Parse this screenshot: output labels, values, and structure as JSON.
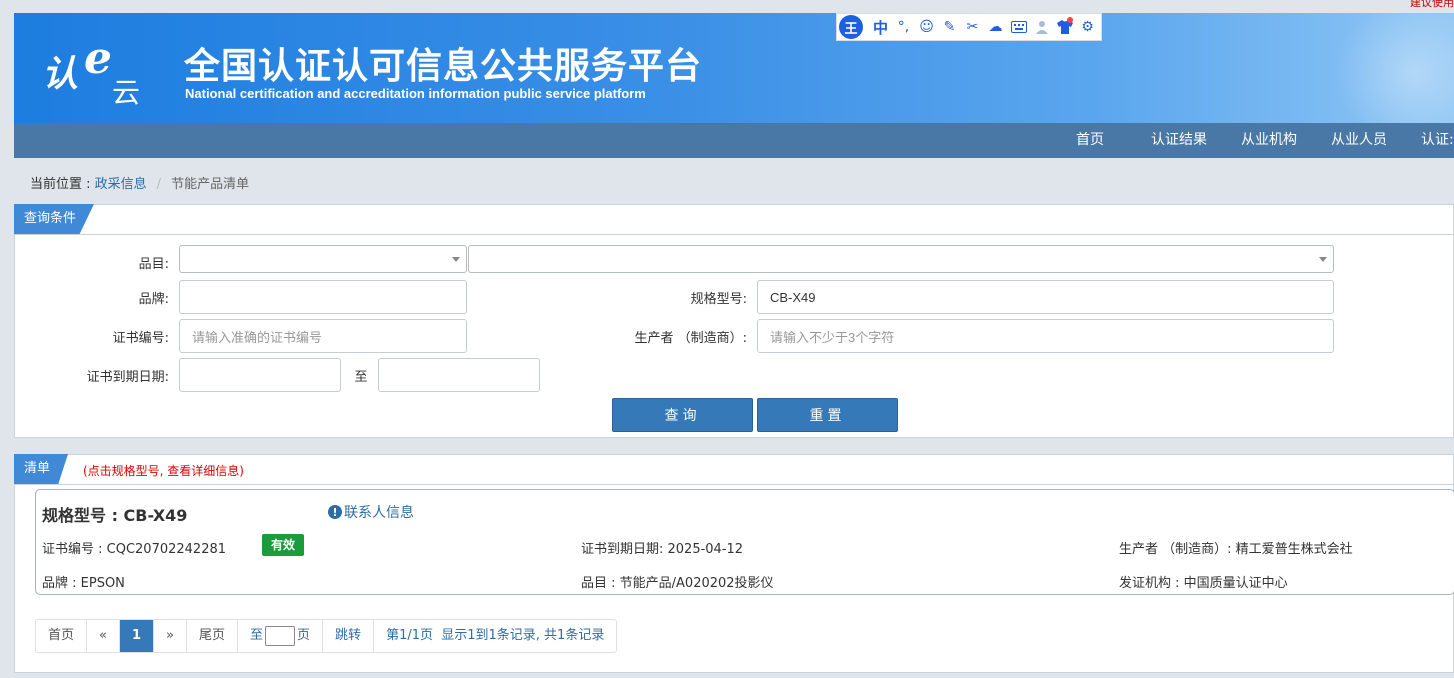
{
  "top_note": "建议使用",
  "header": {
    "logo_char1": "认",
    "logo_char2": "e",
    "logo_char3": "云",
    "title_cn": "全国认证认可信息公共服务平台",
    "title_en": "National certification and accreditation information public service platform"
  },
  "ime_toolbar": {
    "badge": "王",
    "lang": "中",
    "icons": [
      "punctuation-icon",
      "emoji-icon",
      "pen-icon",
      "scissors-icon",
      "cloud-icon",
      "keyboard-icon",
      "user-icon",
      "shirt-icon",
      "gear-icon"
    ]
  },
  "nav": {
    "items": [
      "首页",
      "认证结果",
      "从业机构",
      "从业人员",
      "认证:"
    ]
  },
  "breadcrumb": {
    "prefix": "当前位置 : ",
    "link": "政采信息",
    "sep": "/",
    "current": "节能产品清单"
  },
  "query": {
    "tab": "查询条件",
    "category_label": "品目:",
    "brand_label": "品牌:",
    "brand_value": "",
    "model_label": "规格型号:",
    "model_value": "CB-X49",
    "cert_label": "证书编号:",
    "cert_placeholder": "请输入准确的证书编号",
    "producer_label": "生产者 （制造商）:",
    "producer_placeholder": "请输入不少于3个字符",
    "expiry_label": "证书到期日期:",
    "to_label": "至",
    "search_button": "查询",
    "reset_button": "重置"
  },
  "list": {
    "tab": "清单",
    "hint": "(点击规格型号, 查看详细信息)",
    "item": {
      "model": "规格型号 : CB-X49",
      "contact": "联系人信息",
      "cert_no": "证书编号 : CQC20702242281",
      "status": "有效",
      "expiry": "证书到期日期: 2025-04-12",
      "producer": "生产者 （制造商）: 精工爱普生株式会社",
      "brand": "品牌 : EPSON",
      "category": "品目 : 节能产品/A020202投影仪",
      "issuer": "发证机构 : 中国质量认证中心"
    }
  },
  "pager": {
    "first": "首页",
    "prev": "«",
    "current": "1",
    "next": "»",
    "last": "尾页",
    "goto_prefix": "至",
    "goto_suffix": "页",
    "jump": "跳转",
    "info": "第1/1页  显示1到1条记录, 共1条记录"
  },
  "colors": {
    "nav_bg": "#4a78a6",
    "primary_button": "#3579b8",
    "status_valid": "#1a9b3c",
    "link": "#2e6da4"
  }
}
